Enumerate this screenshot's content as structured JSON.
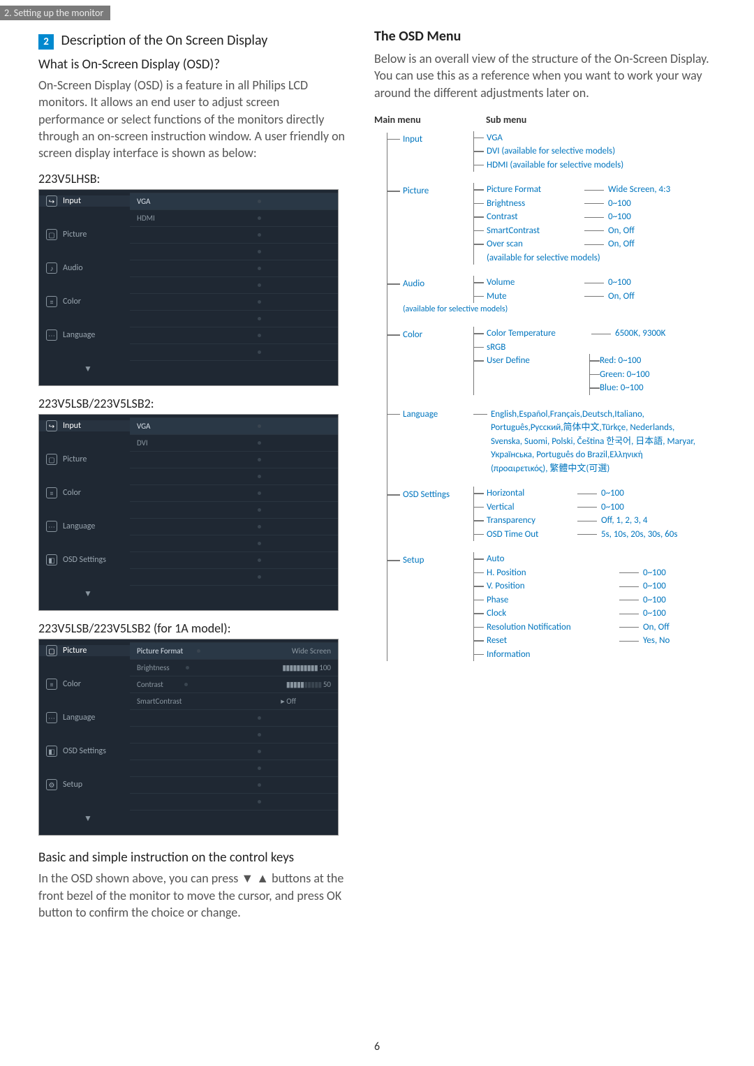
{
  "top_bar": "2. Setting up the monitor",
  "badge_num": "2",
  "left": {
    "section_title": "Description of the On Screen Display",
    "q_heading": "What is On-Screen Display (OSD)?",
    "intro": "On-Screen Display (OSD) is a feature in all Philips LCD monitors. It allows an end user to adjust screen performance or select functions of the monitors directly through an on-screen instruction window. A user friendly on screen display interface is shown as below:",
    "model1_label": "223V5LHSB:",
    "model2_label": "223V5LSB/223V5LSB2:",
    "model3_label": "223V5LSB/223V5LSB2 (for 1A model):",
    "osd1": {
      "menu": [
        "Input",
        "Picture",
        "Audio",
        "Color",
        "Language"
      ],
      "subs": [
        "VGA",
        "HDMI"
      ]
    },
    "osd2": {
      "menu": [
        "Input",
        "Picture",
        "Color",
        "Language",
        "OSD Settings"
      ],
      "subs": [
        "VGA",
        "DVI"
      ]
    },
    "osd3": {
      "menu": [
        "Picture",
        "Color",
        "Language",
        "OSD Settings",
        "Setup"
      ],
      "subs": [
        "Picture Format",
        "Brightness",
        "Contrast",
        "SmartContrast"
      ],
      "vals": [
        "Wide Screen",
        "100",
        "50",
        "Off"
      ]
    },
    "basic_heading": "Basic and simple instruction on the control keys",
    "basic_body": "In the OSD shown above, you can press ▼ ▲ buttons at the front bezel of the monitor to move the cursor, and press OK button to confirm the choice or change."
  },
  "right": {
    "heading": "The OSD Menu",
    "intro": "Below is an overall view of the structure of the On-Screen Display. You can use this as a reference when you want to work your way around the different adjustments later on.",
    "main_header": "Main menu",
    "sub_header": "Sub menu",
    "tree": {
      "input": {
        "label": "Input",
        "items": [
          "VGA",
          "DVI  (available for selective models)",
          "HDMI (available for selective models)"
        ]
      },
      "picture": {
        "label": "Picture",
        "items": [
          {
            "l": "Picture Format",
            "v": "Wide Screen, 4:3"
          },
          {
            "l": "Brightness",
            "v": "0~100"
          },
          {
            "l": "Contrast",
            "v": "0~100"
          },
          {
            "l": "SmartContrast",
            "v": "On, Off"
          },
          {
            "l": "Over scan",
            "v": "On, Off"
          }
        ],
        "note": "(available for selective models)"
      },
      "audio": {
        "label": "Audio",
        "items": [
          {
            "l": "Volume",
            "v": "0~100"
          },
          {
            "l": "Mute",
            "v": "On, Off"
          }
        ],
        "note": "(available for selective models)"
      },
      "color": {
        "label": "Color",
        "items": [
          {
            "l": "Color Temperature",
            "v": "6500K, 9300K"
          },
          {
            "l": "sRGB",
            "v": ""
          },
          {
            "l": "User Define",
            "vlist": [
              "Red: 0~100",
              "Green: 0~100",
              "Blue: 0~100"
            ]
          }
        ]
      },
      "language": {
        "label": "Language",
        "text": "English,Español,Français,Deutsch,Italiano, Português,Русский,简体中文,Türkçe, Nederlands, Svenska, Suomi, Polski, Čeština 한국어, 日本語, Maryar, Українська, Português do Brazil,Ελληνική (προαιρετικός), 繁體中文(可選)"
      },
      "osd_settings": {
        "label": "OSD Settings",
        "items": [
          {
            "l": "Horizontal",
            "v": "0~100"
          },
          {
            "l": "Vertical",
            "v": "0~100"
          },
          {
            "l": "Transparency",
            "v": "Off, 1, 2, 3, 4"
          },
          {
            "l": "OSD Time Out",
            "v": "5s, 10s, 20s, 30s, 60s"
          }
        ]
      },
      "setup": {
        "label": "Setup",
        "items": [
          {
            "l": "Auto",
            "v": ""
          },
          {
            "l": "H. Position",
            "v": "0~100"
          },
          {
            "l": "V. Position",
            "v": "0~100"
          },
          {
            "l": "Phase",
            "v": "0~100"
          },
          {
            "l": "Clock",
            "v": "0~100"
          },
          {
            "l": "Resolution Notification",
            "v": "On, Off"
          },
          {
            "l": "Reset",
            "v": "Yes, No"
          },
          {
            "l": "Information",
            "v": ""
          }
        ]
      }
    }
  },
  "page_num": "6"
}
